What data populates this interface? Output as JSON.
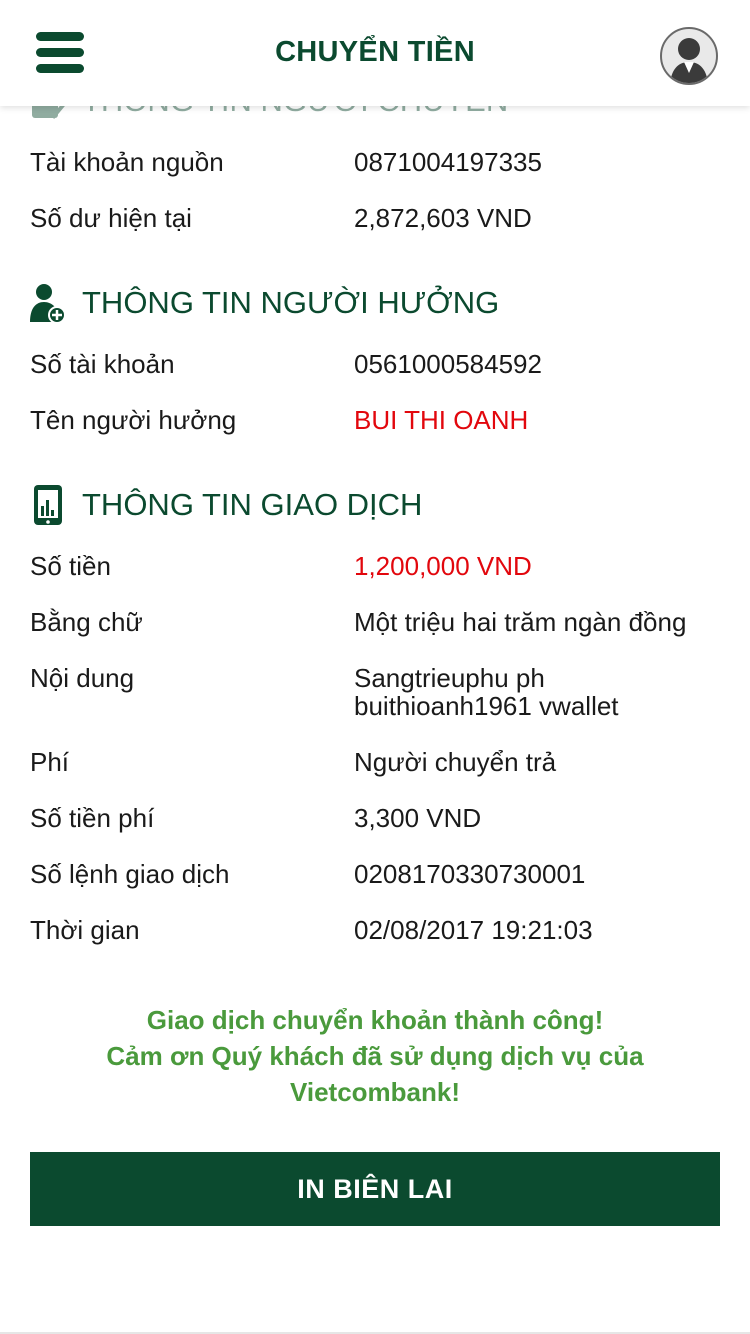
{
  "header": {
    "title": "CHUYỂN TIỀN",
    "menu_icon": "hamburger-menu-icon",
    "avatar_icon": "user-avatar-icon"
  },
  "colors": {
    "primary": "#0b4a2f",
    "highlight": "#e2070d",
    "success": "#4a9a3c"
  },
  "source_section": {
    "title": "THÔNG TIN NGƯỜI CHUYỂN",
    "icon": "wallet-check-icon",
    "rows": [
      {
        "label": "Tài khoản nguồn",
        "value": "0871004197335"
      },
      {
        "label": "Số dư hiện tại",
        "value": "2,872,603 VND"
      }
    ]
  },
  "beneficiary_section": {
    "title": "THÔNG TIN NGƯỜI HƯỞNG",
    "icon": "user-add-icon",
    "rows": [
      {
        "label": "Số tài khoản",
        "value": "0561000584592"
      },
      {
        "label": "Tên người hưởng",
        "value": "BUI THI OANH"
      }
    ]
  },
  "transaction_section": {
    "title": "THÔNG TIN GIAO DỊCH",
    "icon": "mobile-chart-icon",
    "rows": [
      {
        "label": "Số tiền",
        "value": "1,200,000 VND"
      },
      {
        "label": "Bằng chữ",
        "value": "Một triệu hai trăm ngàn đồng"
      },
      {
        "label": "Nội dung",
        "value_line1": "Sangtrieuphu ph",
        "value_line2": "buithioanh1961 vwallet"
      },
      {
        "label": "Phí",
        "value": "Người chuyển trả"
      },
      {
        "label": "Số tiền phí",
        "value": "3,300 VND"
      },
      {
        "label": "Số lệnh giao dịch",
        "value": "0208170330730001"
      },
      {
        "label": "Thời gian",
        "value": "02/08/2017 19:21:03"
      }
    ]
  },
  "success_message": {
    "line1": "Giao dịch chuyển khoản thành công!",
    "line2": "Cảm ơn Quý khách đã sử dụng dịch vụ của",
    "line3": "Vietcombank!"
  },
  "actions": {
    "print_label": "IN BIÊN LAI"
  }
}
